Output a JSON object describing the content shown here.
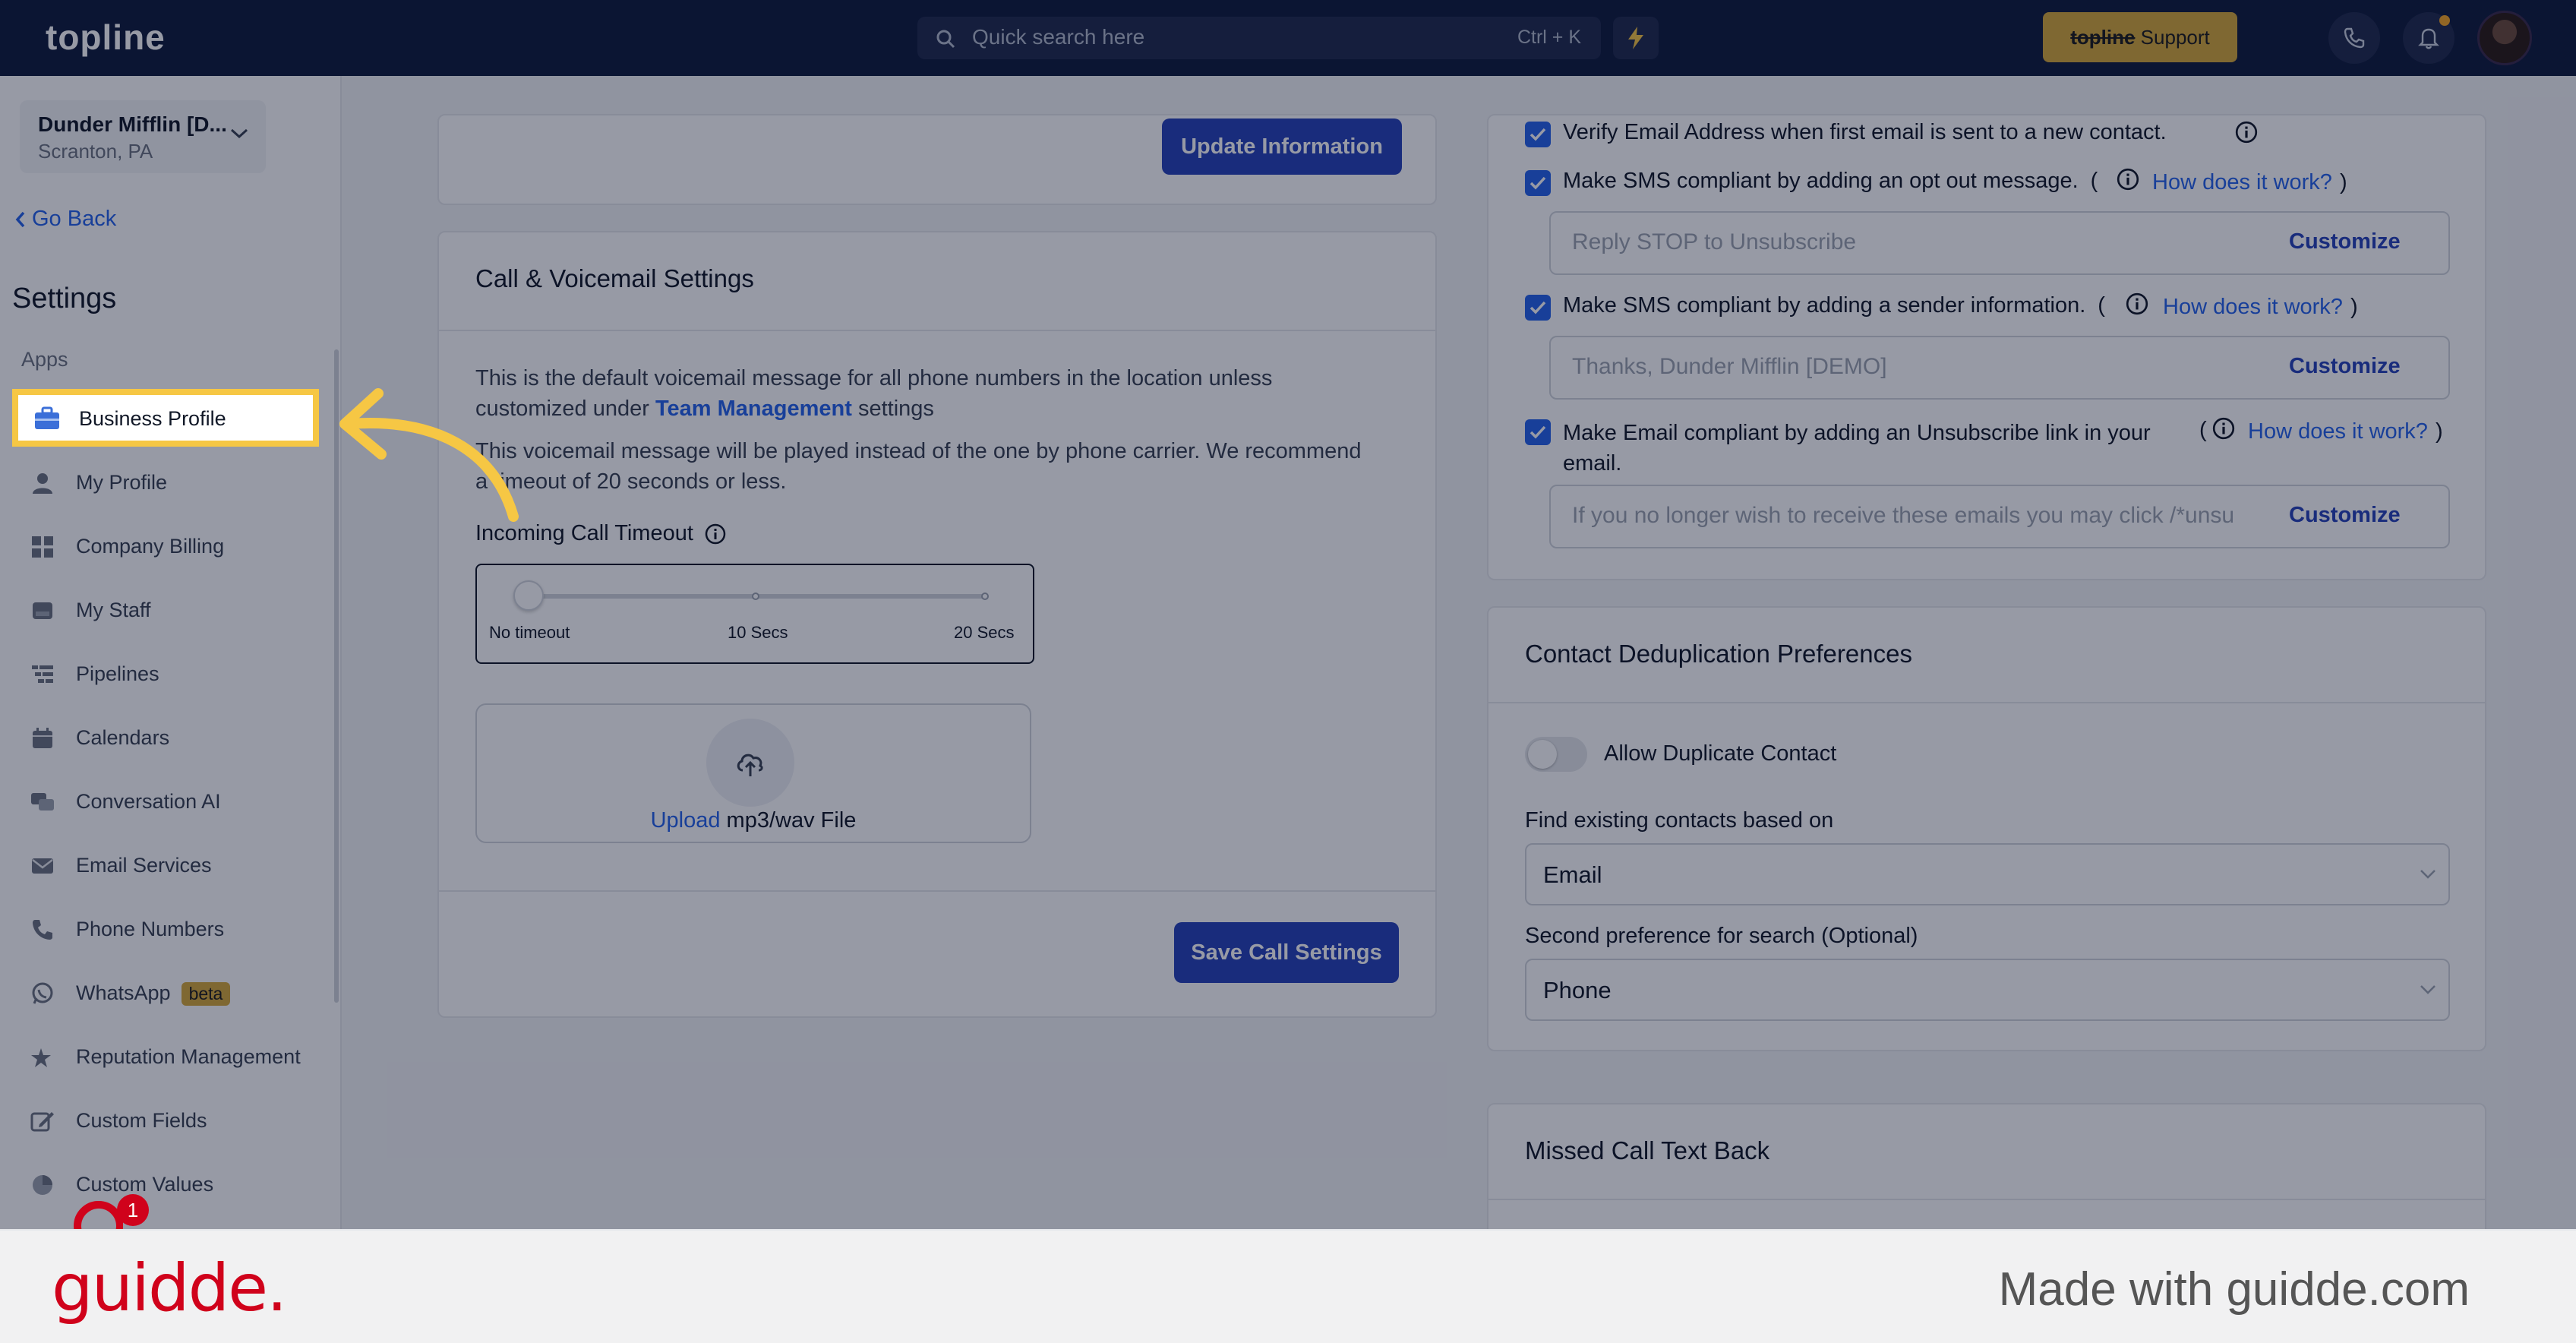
{
  "app": {
    "logo": "topline"
  },
  "topbar": {
    "search_placeholder": "Quick search here",
    "search_shortcut": "Ctrl + K",
    "support_strike": "topline",
    "support_label": " Support"
  },
  "sidebar": {
    "location_name": "Dunder Mifflin [D...",
    "location_sub": "Scranton, PA",
    "go_back": "Go Back",
    "settings_title": "Settings",
    "section_apps": "Apps",
    "items": [
      {
        "label": "Business Profile",
        "icon": "briefcase-icon"
      },
      {
        "label": "My Profile",
        "icon": "person-icon"
      },
      {
        "label": "Company Billing",
        "icon": "grid-icon"
      },
      {
        "label": "My Staff",
        "icon": "staff-icon"
      },
      {
        "label": "Pipelines",
        "icon": "pipeline-icon"
      },
      {
        "label": "Calendars",
        "icon": "calendar-icon"
      },
      {
        "label": "Conversation AI",
        "icon": "chat-icon"
      },
      {
        "label": "Email Services",
        "icon": "mail-icon"
      },
      {
        "label": "Phone Numbers",
        "icon": "phone-icon"
      },
      {
        "label": "WhatsApp",
        "icon": "whatsapp-icon",
        "badge": "beta"
      },
      {
        "label": "Reputation Management",
        "icon": "star-icon"
      },
      {
        "label": "Custom Fields",
        "icon": "edit-icon"
      },
      {
        "label": "Custom Values",
        "icon": "pie-icon"
      }
    ],
    "widget_count": "1"
  },
  "business_card": {
    "update_button": "Update Information"
  },
  "call_settings": {
    "title": "Call & Voicemail Settings",
    "desc1_prefix": "This is the default voicemail message for all phone numbers in the location unless",
    "desc1_line2_prefix": "customized under ",
    "desc1_link": "Team Management",
    "desc1_suffix": " settings",
    "desc2_line1": "This voicemail message will be played instead of the one by phone carrier. We recommend",
    "desc2_line2": "a timeout of 20 seconds or less.",
    "timeout_label": "Incoming Call Timeout",
    "slider_labels": [
      "No timeout",
      "10 Secs",
      "20 Secs"
    ],
    "slider_value": 0,
    "upload_link": "Upload",
    "upload_text": " mp3/wav File",
    "save_button": "Save Call Settings"
  },
  "compliance": {
    "verify_email": "Verify Email Address when first email is sent to a new contact.",
    "sms_optout": "Make SMS compliant by adding an opt out message.",
    "sms_optout_placeholder": "Reply STOP to Unsubscribe",
    "sms_sender": "Make SMS compliant by adding a sender information.",
    "sms_sender_placeholder": "Thanks, Dunder Mifflin [DEMO]",
    "email_unsub_line1": "Make Email compliant by adding an Unsubscribe link in your",
    "email_unsub_line2": "email.",
    "email_unsub_placeholder": "If you no longer wish to receive these emails you may click /*unsu",
    "how_link": "How does it work?",
    "customize": "Customize",
    "paren_open": "(",
    "paren_close": ")"
  },
  "dedup": {
    "title": "Contact Deduplication Preferences",
    "allow_label": "Allow Duplicate Contact",
    "allow_on": false,
    "find_label": "Find existing contacts based on",
    "find_value": "Email",
    "second_label": "Second preference for search (Optional)",
    "second_value": "Phone"
  },
  "missed_call": {
    "title": "Missed Call Text Back"
  },
  "footer": {
    "brand": "guidde.",
    "made_with": "Made with guidde.com"
  },
  "colors": {
    "accent": "#2642b8",
    "highlight": "#f6c744",
    "brand_red": "#d0021b",
    "topbar": "#0f1a3c"
  }
}
